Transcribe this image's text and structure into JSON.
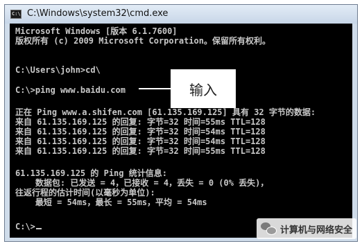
{
  "window": {
    "title": "C:\\Windows\\system32\\cmd.exe",
    "icon_text": "C:\\"
  },
  "console": {
    "lines": [
      "Microsoft Windows [版本 6.1.7600]",
      "版权所有 (c) 2009 Microsoft Corporation。保留所有权利。",
      "",
      "C:\\Users\\john>cd\\",
      "",
      "C:\\>ping www.baidu.com",
      "",
      "正在 Ping www.a.shifen.com [61.135.169.125] 具有 32 字节的数据:",
      "来自 61.135.169.125 的回复: 字节=32 时间=55ms TTL=128",
      "来自 61.135.169.125 的回复: 字节=32 时间=54ms TTL=128",
      "来自 61.135.169.125 的回复: 字节=32 时间=54ms TTL=128",
      "来自 61.135.169.125 的回复: 字节=32 时间=55ms TTL=128",
      "",
      "61.135.169.125 的 Ping 统计信息:",
      "    数据包: 已发送 = 4，已接收 = 4，丢失 = 0 (0% 丢失)，",
      "往返行程的估计时间(以毫秒为单位):",
      "    最短 = 54ms，最长 = 55ms，平均 = 54ms",
      "",
      "C:\\>"
    ]
  },
  "annotation": {
    "callout_text": "输入"
  },
  "watermark": {
    "text": "计算机与网络安全",
    "icon": "wechat-icon"
  }
}
